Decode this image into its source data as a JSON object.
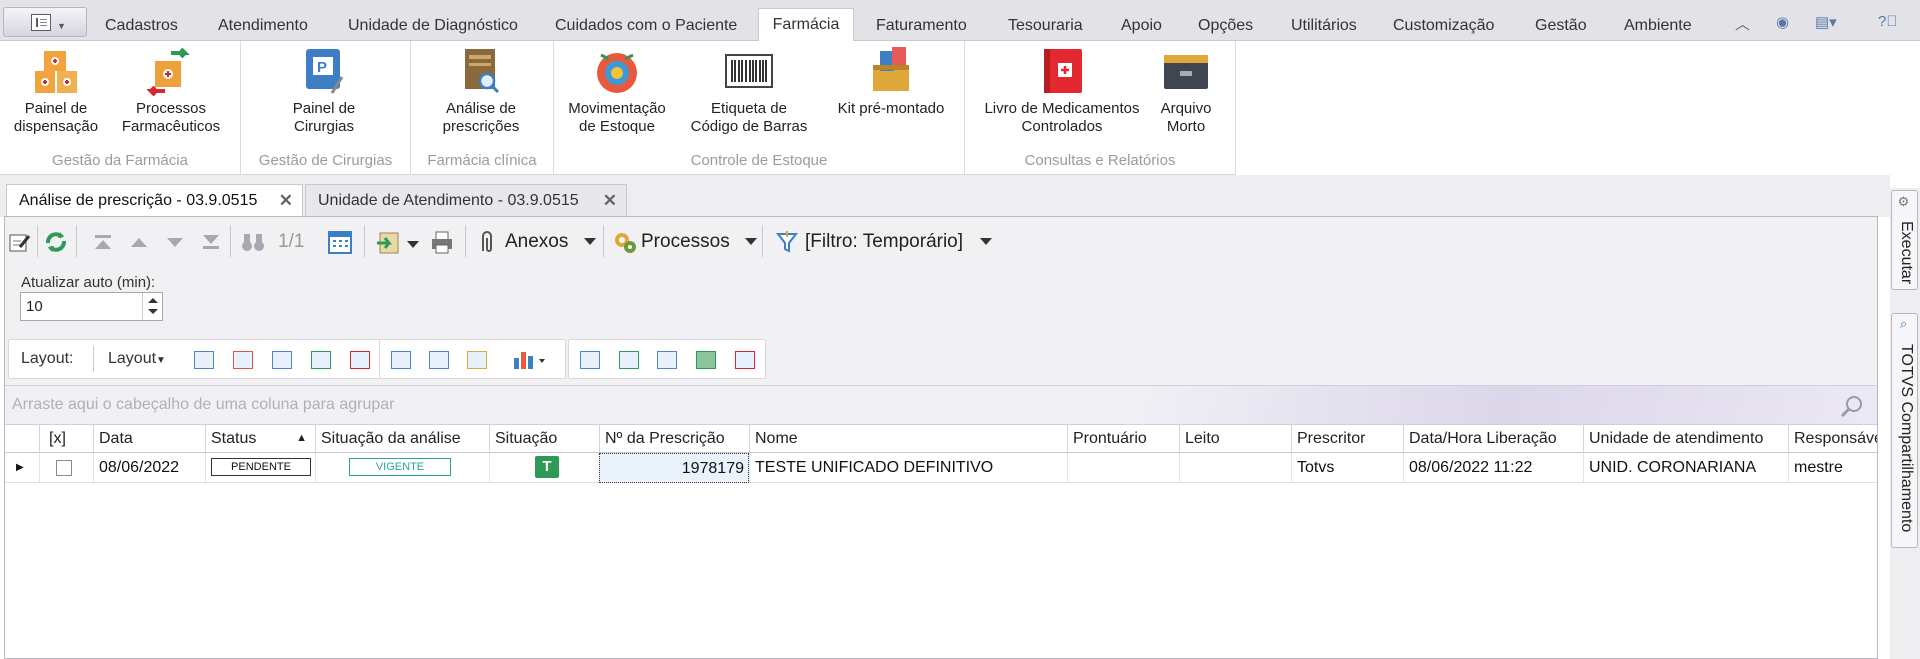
{
  "menu": {
    "tabs": [
      "Cadastros",
      "Atendimento",
      "Unidade de Diagnóstico",
      "Cuidados com o Paciente",
      "Farmácia",
      "Faturamento",
      "Tesouraria",
      "Apoio",
      "Opções",
      "Utilitários",
      "Customização",
      "Gestão",
      "Ambiente"
    ],
    "active_tab": "Farmácia",
    "right_icons": [
      "chevron-up-icon",
      "globe-icon",
      "layout-icon",
      "help-icon"
    ]
  },
  "ribbon": {
    "groups": [
      {
        "caption": "Gestão da Farmácia",
        "buttons": [
          {
            "label": "Painel de\ndispensação",
            "icon": "dispensation-boxes-icon"
          },
          {
            "label": "Processos\nFarmacêuticos",
            "icon": "pharma-process-icon"
          }
        ]
      },
      {
        "caption": "Gestão de Cirurgias",
        "buttons": [
          {
            "label": "Painel de\nCirurgias",
            "icon": "surgery-panel-icon"
          }
        ]
      },
      {
        "caption": "Farmácia clínica",
        "buttons": [
          {
            "label": "Análise de\nprescrições",
            "icon": "prescription-analysis-icon"
          }
        ]
      },
      {
        "caption": "Controle de Estoque",
        "buttons": [
          {
            "label": "Movimentação\nde Estoque",
            "icon": "stock-movement-icon"
          },
          {
            "label": "Etiqueta de\nCódigo de Barras",
            "icon": "barcode-icon"
          },
          {
            "label": "Kit pré-montado",
            "icon": "kit-icon"
          }
        ]
      },
      {
        "caption": "Consultas e Relatórios",
        "buttons": [
          {
            "label": "Livro de Medicamentos\nControlados",
            "icon": "controlled-book-icon"
          },
          {
            "label": "Arquivo\nMorto",
            "icon": "archive-icon"
          }
        ]
      }
    ]
  },
  "doc_tabs": [
    {
      "label": "Análise de prescrição - 03.9.0515",
      "active": true
    },
    {
      "label": "Unidade de Atendimento - 03.9.0515",
      "active": false
    }
  ],
  "toolbar": {
    "record_counter": "1/1",
    "anexos": "Anexos",
    "processos": "Processos",
    "filter": "[Filtro: Temporário]"
  },
  "auto_refresh": {
    "label": "Atualizar auto (min):",
    "value": "10"
  },
  "layout_bar": {
    "label": "Layout:",
    "dropdown": "Layout"
  },
  "group_area": {
    "placeholder": "Arraste aqui o cabeçalho de uma coluna para agrupar"
  },
  "grid": {
    "columns": [
      "[x]",
      "Data",
      "Status",
      "Situação da análise",
      "Situação",
      "Nº da Prescrição",
      "Nome",
      "Prontuário",
      "Leito",
      "Prescritor",
      "Data/Hora Liberação",
      "Unidade de atendimento",
      "Responsável"
    ],
    "rows": [
      {
        "checked": false,
        "data": "08/06/2022",
        "status": "PENDENTE",
        "situacao_analise": "VIGENTE",
        "situacao": "T",
        "prescricao": "1978179",
        "nome": "TESTE UNIFICADO DEFINITIVO",
        "prontuario": "",
        "leito": "",
        "prescritor": "Totvs",
        "liberacao": "08/06/2022 11:22",
        "unidade": "UNID. CORONARIANA",
        "responsavel": "mestre"
      }
    ]
  },
  "side_panels": [
    "Executar",
    "TOTVS Compartilhamento"
  ],
  "colors": {
    "accent": "#3c7fc4",
    "vigente": "#2aa59a",
    "situacao_badge": "#2f9a57"
  }
}
